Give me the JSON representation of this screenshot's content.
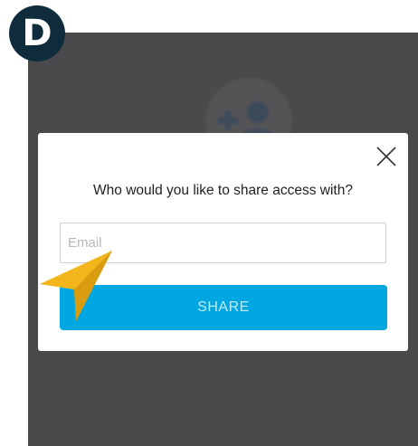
{
  "step_badge": "D",
  "dialog": {
    "prompt": "Who would you like to share access with?",
    "email_placeholder": "Email",
    "email_value": "",
    "share_label": "SHARE"
  },
  "icons": {
    "background_avatar": "add-user-icon",
    "close": "close-icon",
    "pointer": "arrow-pointer-icon"
  },
  "colors": {
    "badge": "#0f2c3d",
    "share_button": "#00a7e0",
    "overlay": "#4a4a4c",
    "pointer": "#f2b51b"
  }
}
